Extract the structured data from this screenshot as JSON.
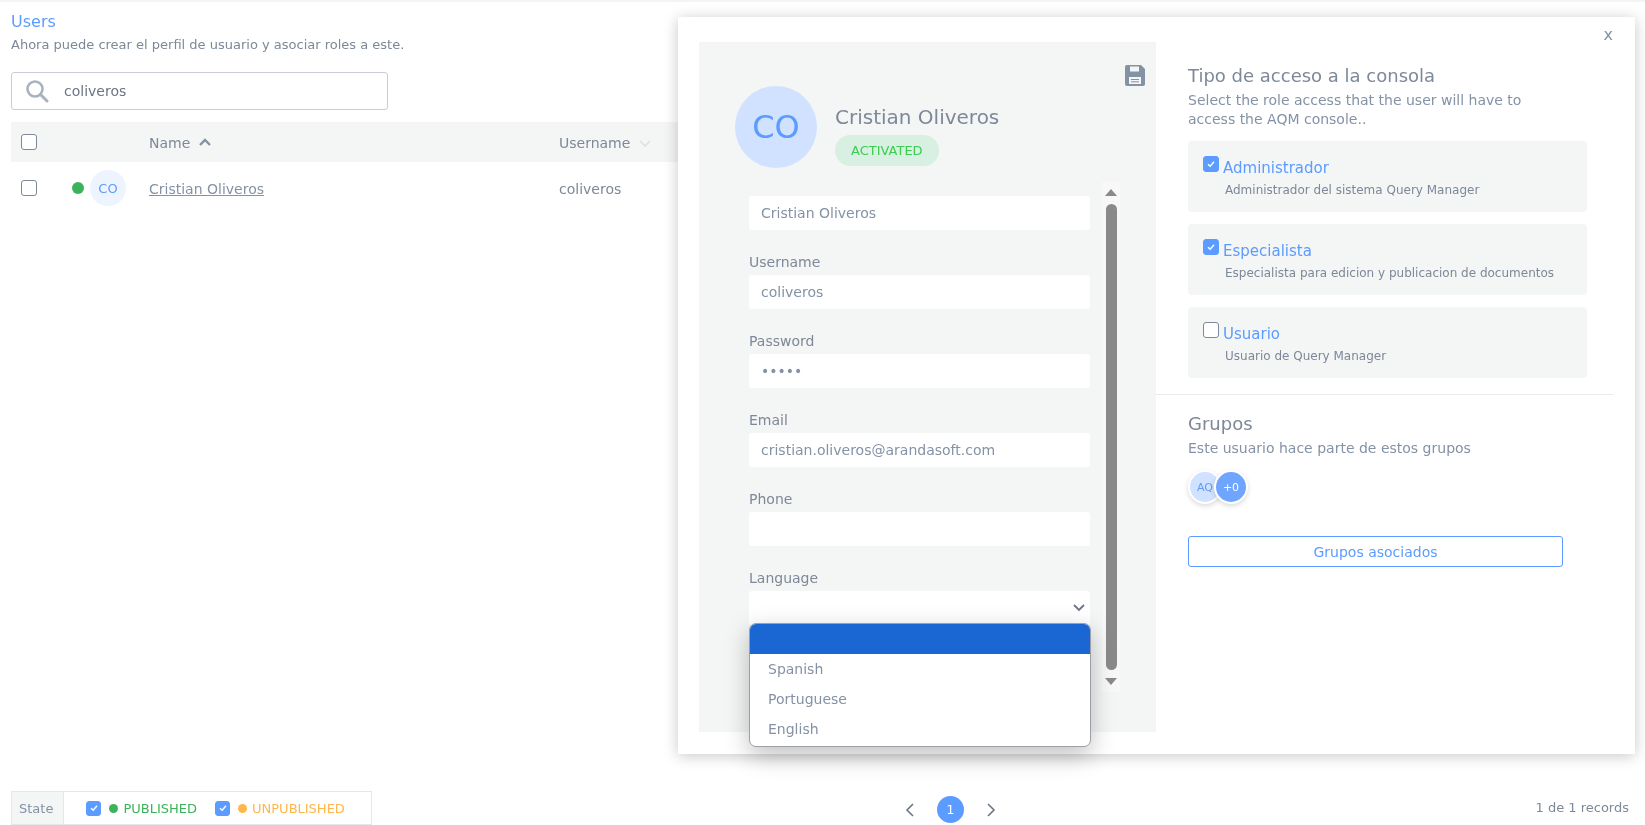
{
  "page": {
    "title": "Users",
    "subtitle": "Ahora puede crear el perfil de usuario y asociar roles a este."
  },
  "search": {
    "value": "coliveros"
  },
  "table": {
    "header_checked": false,
    "columns": [
      {
        "label": "Name",
        "sorted": true
      },
      {
        "label": "Username",
        "sorted": false
      }
    ],
    "rows": [
      {
        "checked": false,
        "color": "#3cb35a",
        "initials": "CO",
        "name": "Cristian Oliveros",
        "username": "coliveros"
      }
    ]
  },
  "modal": {
    "profile": {
      "initials": "CO",
      "name": "Cristian Oliveros",
      "status": "ACTIVATED"
    },
    "fields": [
      {
        "kind": "text",
        "value": "Cristian Oliveros"
      },
      {
        "kind": "text",
        "label": "Username",
        "value": "coliveros"
      },
      {
        "kind": "text",
        "label": "Password",
        "value": "•••••"
      },
      {
        "kind": "text",
        "label": "Email",
        "value": "cristian.oliveros@arandasoft.com"
      },
      {
        "kind": "text",
        "label": "Phone"
      },
      {
        "kind": "select",
        "label": "Language",
        "open": true,
        "blank_highlighted": true,
        "options": [
          {
            "label": "Spanish",
            "selected": false
          },
          {
            "label": "Portuguese",
            "selected": false
          },
          {
            "label": "English",
            "selected": false
          }
        ]
      }
    ],
    "access": {
      "title": "Tipo de acceso a la consola",
      "subtitle": "Select the role access that the user will have to access the AQM console..",
      "roles": [
        {
          "title": "Administrador",
          "description": "Administrador del sistema Query Manager",
          "checked": true
        },
        {
          "title": "Especialista",
          "description": "Especialista para edicion y publicacion de documentos",
          "checked": true
        },
        {
          "title": "Usuario",
          "description": "Usuario de Query Manager",
          "checked": false
        }
      ]
    },
    "groups": {
      "title": "Grupos",
      "subtitle": "Este usuario hace parte de estos grupos",
      "avatars": [
        {
          "kind": "initials",
          "text": "AQ"
        },
        {
          "kind": "more",
          "text": "+0"
        }
      ],
      "button": "Grupos asociados"
    },
    "close": "x"
  },
  "footer": {
    "state": {
      "label": "State",
      "options": [
        {
          "label": "PUBLISHED",
          "checked": true,
          "color": "#3cb35a"
        },
        {
          "label": "UNPUBLISHED",
          "checked": true,
          "color": "#ffb74d"
        }
      ]
    },
    "pages": [
      {
        "label": "1",
        "selected": true
      }
    ],
    "records": "1 de 1 records"
  }
}
